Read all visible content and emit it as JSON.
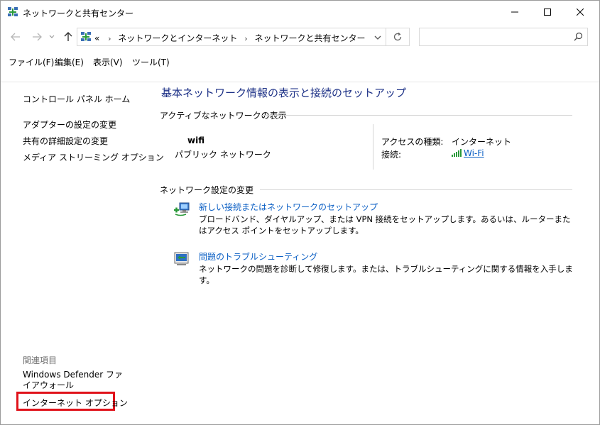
{
  "window": {
    "title": "ネットワークと共有センター"
  },
  "nav": {
    "breadcrumb_prefix": "«",
    "breadcrumb_1": "ネットワークとインターネット",
    "breadcrumb_sep": "›",
    "breadcrumb_2": "ネットワークと共有センター",
    "search_placeholder": ""
  },
  "menu": {
    "file": "ファイル(F)",
    "edit": "編集(E)",
    "view": "表示(V)",
    "tools": "ツール(T)"
  },
  "sidebar": {
    "home": "コントロール パネル ホーム",
    "items": [
      {
        "label": "アダプターの設定の変更"
      },
      {
        "label": "共有の詳細設定の変更"
      },
      {
        "label": "メディア ストリーミング オプション"
      }
    ],
    "related_heading": "関連項目",
    "related": [
      {
        "label": "Windows Defender ファイアウォール"
      },
      {
        "label": "インターネット オプション"
      }
    ]
  },
  "main": {
    "title": "基本ネットワーク情報の表示と接続のセットアップ",
    "active_section": "アクティブなネットワークの表示",
    "network": {
      "name": "wifi",
      "type": "パブリック ネットワーク",
      "access_label": "アクセスの種類:",
      "access_value": "インターネット",
      "connection_label": "接続:",
      "connection_value": "Wi-Fi"
    },
    "settings_section": "ネットワーク設定の変更",
    "tasks": [
      {
        "link": "新しい接続またはネットワークのセットアップ",
        "desc": "ブロードバンド、ダイヤルアップ、または VPN 接続をセットアップします。あるいは、ルーターまたはアクセス ポイントをセットアップします。"
      },
      {
        "link": "問題のトラブルシューティング",
        "desc": "ネットワークの問題を診断して修復します。または、トラブルシューティングに関する情報を入手します。"
      }
    ]
  },
  "colors": {
    "link": "#0b5fc4",
    "title": "#1e3287",
    "highlight_box": "#e0121a"
  }
}
